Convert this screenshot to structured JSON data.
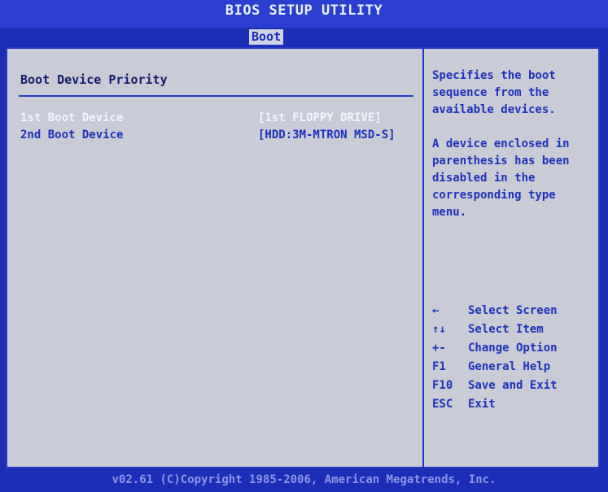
{
  "window": {
    "title": "BIOS SETUP UTILITY"
  },
  "menu": {
    "active_tab": "Boot"
  },
  "main": {
    "section_title": "Boot Device Priority",
    "items": [
      {
        "label": "1st Boot Device",
        "value": "[1st FLOPPY DRIVE]",
        "selected": true
      },
      {
        "label": "2nd Boot Device",
        "value": "[HDD:3M-MTRON MSD-S]",
        "selected": false
      }
    ]
  },
  "help": {
    "text": "Specifies the boot\nsequence from the\navailable devices.\n\nA device enclosed in\nparenthesis has been\ndisabled in the\ncorresponding type\nmenu."
  },
  "keys": [
    {
      "key": "←",
      "desc": "Select Screen"
    },
    {
      "key": "↑↓",
      "desc": "Select Item"
    },
    {
      "key": "+-",
      "desc": "Change Option"
    },
    {
      "key": "F1",
      "desc": "General Help"
    },
    {
      "key": "F10",
      "desc": "Save and Exit"
    },
    {
      "key": "ESC",
      "desc": "Exit"
    }
  ],
  "footer": {
    "text": "v02.61 (C)Copyright 1985-2006, American Megatrends, Inc."
  },
  "colors": {
    "background_blue": "#1a2fb5",
    "panel_gray": "#c9cbd7",
    "text_blue": "#1f31b8",
    "selected_text": "#f2f4ff"
  }
}
